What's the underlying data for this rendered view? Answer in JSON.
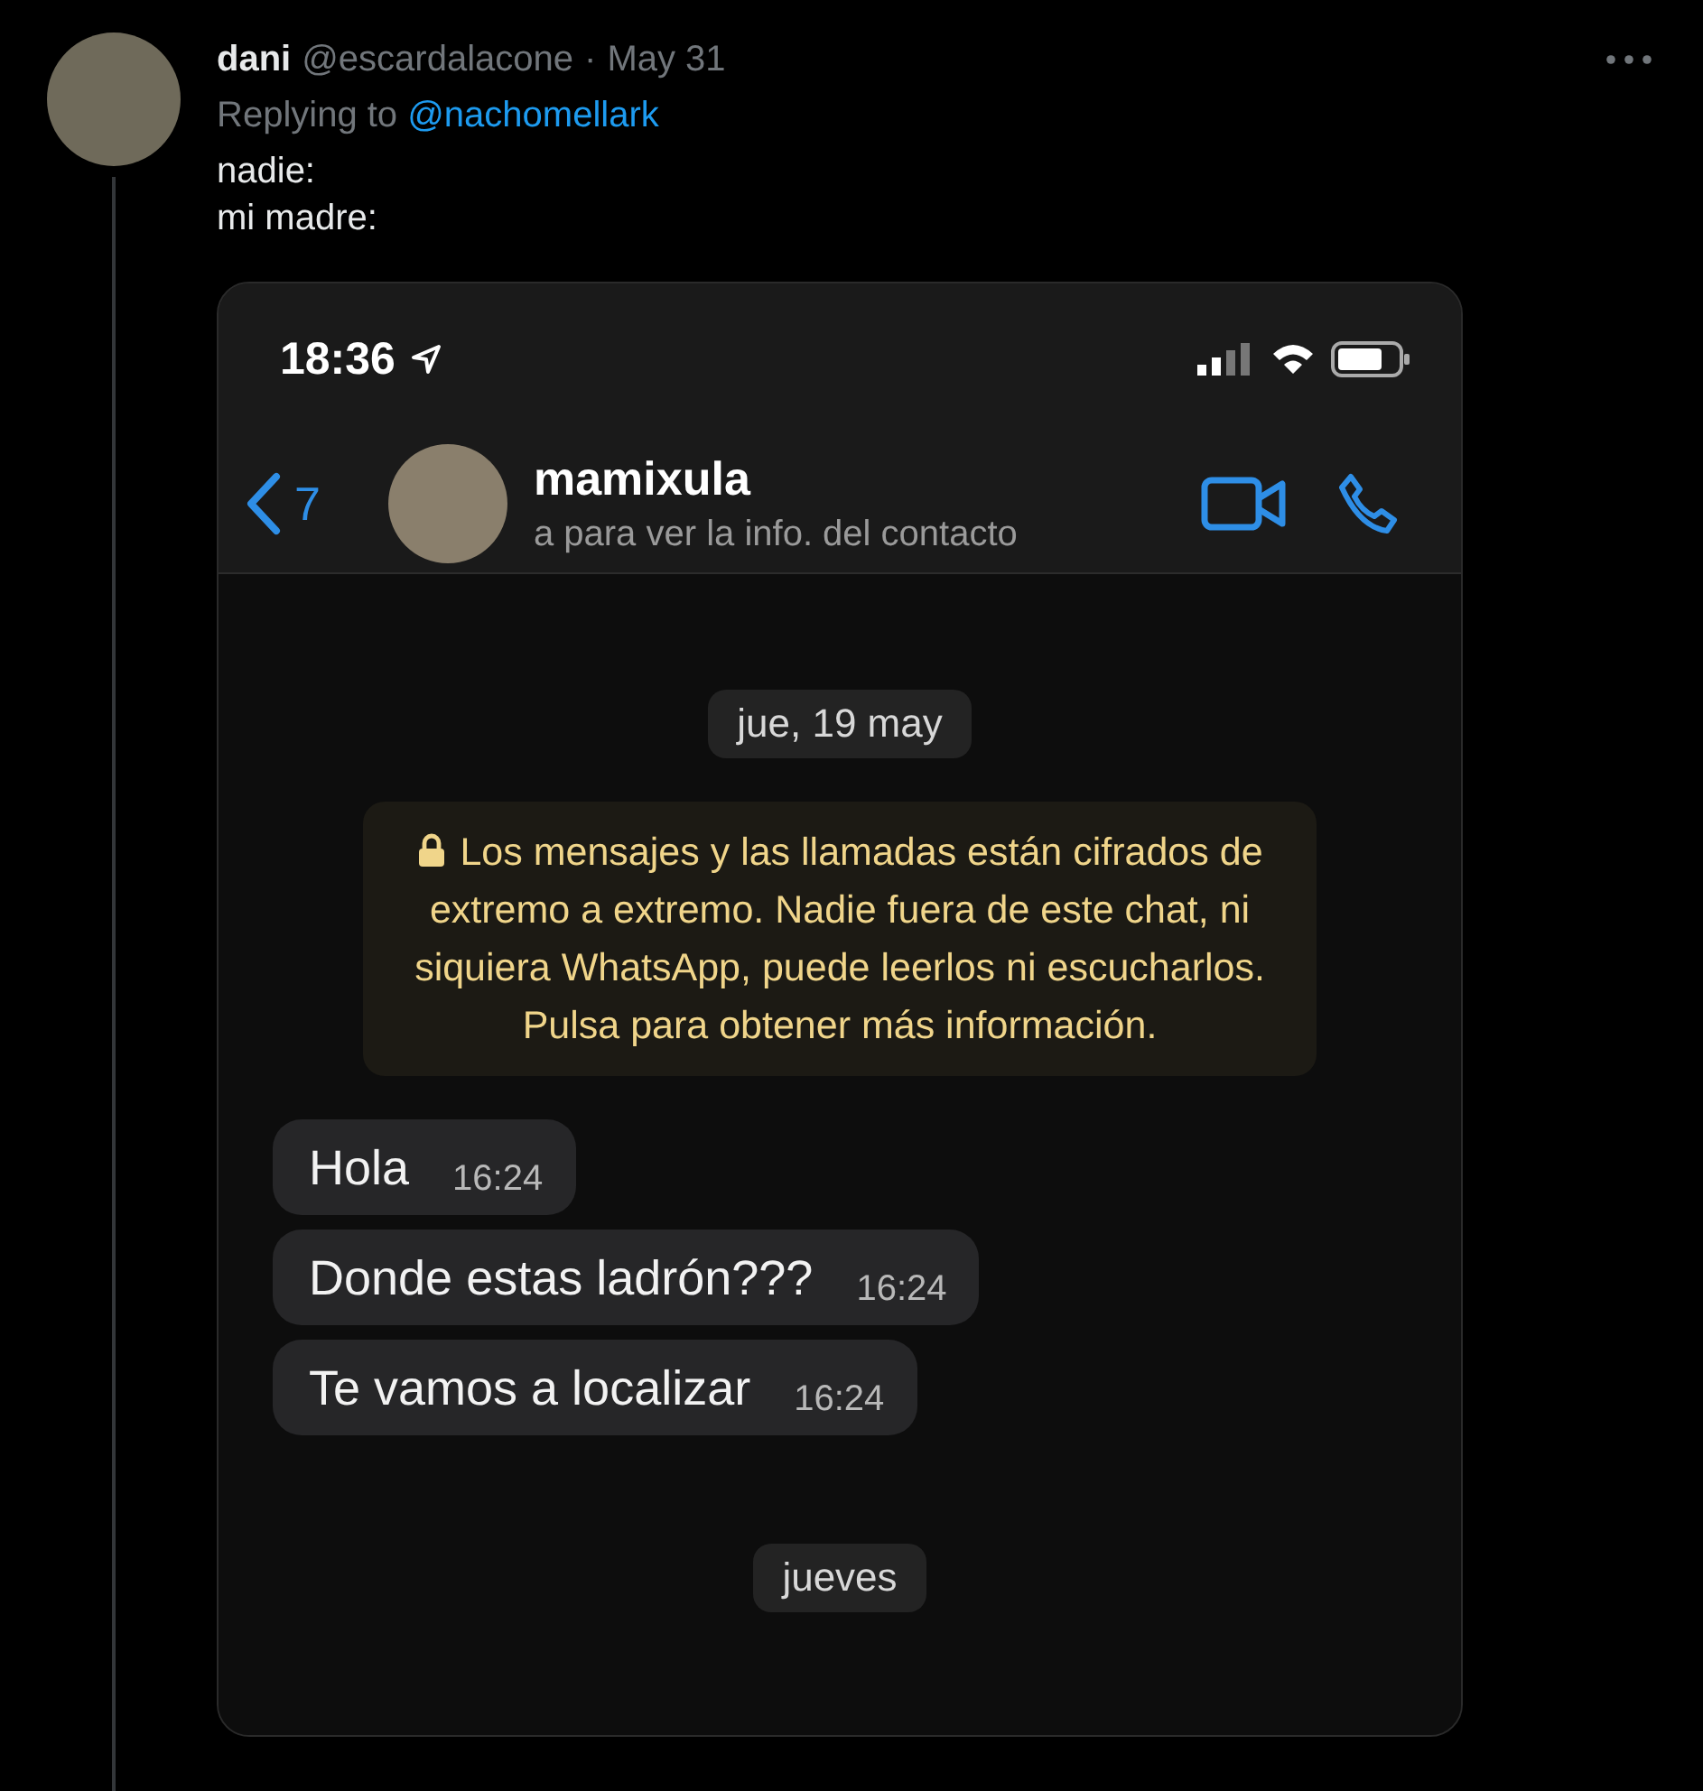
{
  "tweet": {
    "author": {
      "name": "dani",
      "handle": "@escardalacone",
      "separator": "·",
      "date": "May 31"
    },
    "reply": {
      "prefix": "Replying to",
      "mention": "@nachomellark"
    },
    "lines": [
      "nadie:",
      "mi madre:"
    ]
  },
  "screenshot": {
    "status_bar": {
      "time": "18:36"
    },
    "chat_header": {
      "back_count": "7",
      "contact": "mamixula",
      "subtitle": "a para ver la info. del contacto"
    },
    "date_chip": "jue, 19 may",
    "notice": "Los mensajes y las llamadas están cifrados de extremo a extremo. Nadie fuera de este chat, ni siquiera WhatsApp, puede leerlos ni escucharlos. Pulsa para obtener más información.",
    "messages": [
      {
        "text": "Hola",
        "time": "16:24"
      },
      {
        "text": "Donde estas ladrón???",
        "time": "16:24"
      },
      {
        "text": "Te vamos a localizar",
        "time": "16:24"
      }
    ],
    "bottom_chip": "jueves"
  }
}
